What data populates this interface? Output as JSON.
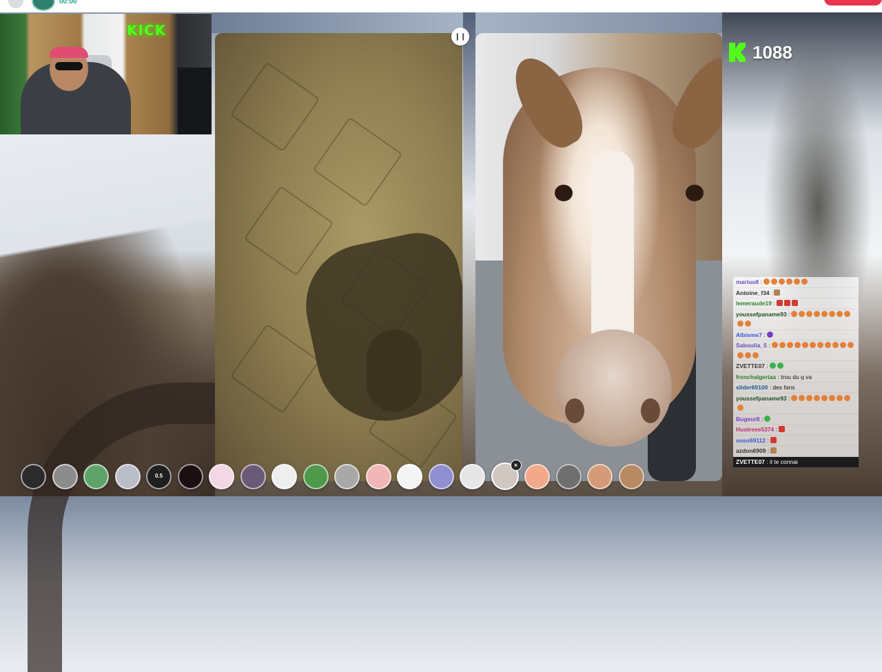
{
  "topbar": {
    "time": "00:00"
  },
  "webcam": {
    "sign_text": "KICK"
  },
  "viewers": {
    "count": "1088",
    "brand_color": "#53fc18"
  },
  "chat": {
    "messages": [
      {
        "user": "mariuo8",
        "text": " :",
        "emotes": [
          "e",
          "e",
          "e",
          "e",
          "e",
          "e"
        ],
        "color": "#6a4bc4"
      },
      {
        "user": "Antoine_f34",
        "text": " :",
        "emotes": [
          "t"
        ],
        "color": "#333333"
      },
      {
        "user": "lemeraude19",
        "text": " :",
        "emotes": [
          "r",
          "r",
          "r"
        ],
        "color": "#2a7d2a"
      },
      {
        "user": "youssefpaname93",
        "text": " :",
        "emotes": [
          "e",
          "e",
          "e",
          "e",
          "e",
          "e",
          "e",
          "e",
          "e",
          "e"
        ],
        "color": "#1e4d1e"
      },
      {
        "user": "Albisme7",
        "text": " :",
        "emotes": [
          "p"
        ],
        "color": "#3a56d6"
      },
      {
        "user": "Saboulia_5",
        "text": " :",
        "emotes": [
          "e",
          "e",
          "e",
          "e",
          "e",
          "e",
          "e",
          "e",
          "e",
          "e",
          "e",
          "e",
          "e",
          "e"
        ],
        "color": "#6a4bc4"
      },
      {
        "user": "ZVETTE07",
        "text": " :",
        "emotes": [
          "g",
          "g"
        ],
        "color": "#333333"
      },
      {
        "user": "frenchalgeriaa",
        "text": " : trou du q va",
        "emotes": [],
        "color": "#2a7d2a"
      },
      {
        "user": "slider69100",
        "text": " : des fans",
        "emotes": [],
        "color": "#1e5a8a"
      },
      {
        "user": "youssefpaname93",
        "text": " :",
        "emotes": [
          "e",
          "e",
          "e",
          "e",
          "e",
          "e",
          "e",
          "e",
          "e"
        ],
        "color": "#1e4d1e"
      },
      {
        "user": "Bugeur8",
        "text": " :",
        "emotes": [
          "g"
        ],
        "color": "#7a3cc4"
      },
      {
        "user": "Hustreee5374",
        "text": " :",
        "emotes": [
          "r"
        ],
        "color": "#c22f6e"
      },
      {
        "user": "soso69112",
        "text": " :",
        "emotes": [
          "r"
        ],
        "color": "#3a56d6"
      },
      {
        "user": "azdon6909",
        "text": " :",
        "emotes": [
          "t"
        ],
        "color": "#333333"
      },
      {
        "user": "ZVETTE07",
        "text": " : il te connai",
        "emotes": [],
        "color": "#ffffff",
        "dark": true
      }
    ]
  },
  "reactions": [
    {
      "name": "black-ring-reaction",
      "bg": "#2b2b2b",
      "label": ""
    },
    {
      "name": "face-neutral-reaction",
      "bg": "#8c8c8c",
      "label": ""
    },
    {
      "name": "alien-reaction",
      "bg": "#5fa36a",
      "label": ""
    },
    {
      "name": "ghost-reaction",
      "bg": "#b9bdc8",
      "label": ""
    },
    {
      "name": "speed-reaction",
      "bg": "#1f1f1f",
      "label": "0.5"
    },
    {
      "name": "devil-reaction",
      "bg": "#1b0f12",
      "label": ""
    },
    {
      "name": "cat-reaction",
      "bg": "#f3d7e3",
      "label": ""
    },
    {
      "name": "monkey-reaction",
      "bg": "#6a5a78",
      "label": ""
    },
    {
      "name": "panda-reaction",
      "bg": "#eeeeee",
      "label": ""
    },
    {
      "name": "zombie-reaction",
      "bg": "#4f9a4a",
      "label": ""
    },
    {
      "name": "sad-face-reaction",
      "bg": "#a8a8a8",
      "label": ""
    },
    {
      "name": "blush-reaction",
      "bg": "#f2b6b6",
      "label": ""
    },
    {
      "name": "stars-reaction",
      "bg": "#f4f4f4",
      "label": ""
    },
    {
      "name": "galaxy-reaction",
      "bg": "#8f8fd1",
      "label": ""
    },
    {
      "name": "robot-reaction",
      "bg": "#e6e6e6",
      "label": ""
    },
    {
      "name": "donkey-reaction",
      "bg": "#cfc7c0",
      "label": "",
      "selected": true
    },
    {
      "name": "peach-reaction",
      "bg": "#f2a98a",
      "label": ""
    },
    {
      "name": "mask-reaction",
      "bg": "#6f6f6f",
      "label": ""
    },
    {
      "name": "human-face-reaction",
      "bg": "#d59a78",
      "label": ""
    },
    {
      "name": "dog-reaction",
      "bg": "#b78a63",
      "label": ""
    }
  ]
}
